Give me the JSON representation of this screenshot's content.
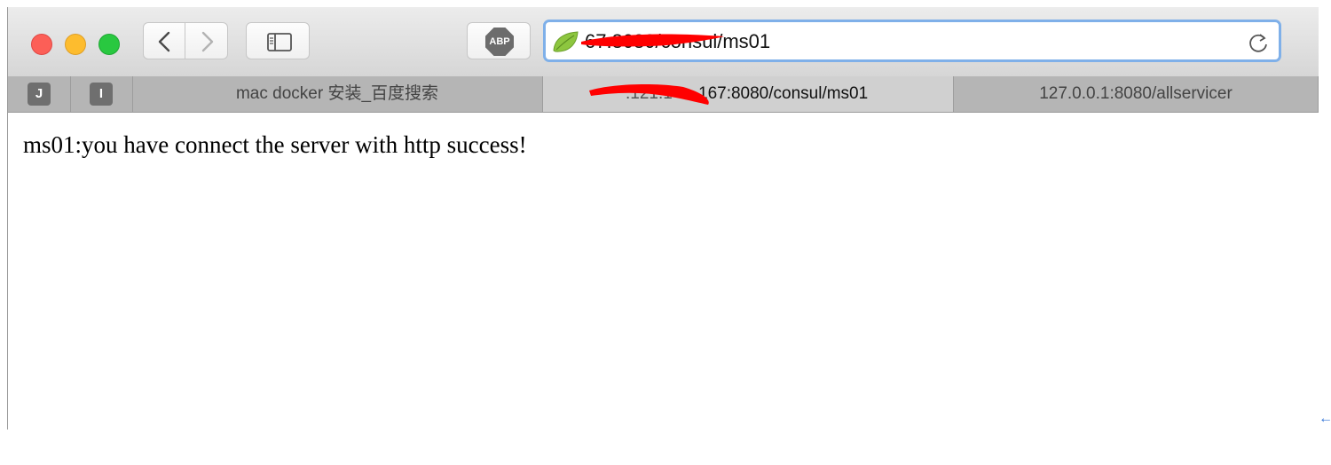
{
  "toolbar": {
    "abp_label": "ABP",
    "url": "67:8080/consul/ms01"
  },
  "pinned_tabs": [
    "J",
    "I"
  ],
  "tabs": [
    {
      "label": "mac docker 安装_百度搜索"
    },
    {
      "label": "167:8080/consul/ms01",
      "redacted_prefix": ".121.1"
    },
    {
      "label": "127.0.0.1:8080/allservicer"
    }
  ],
  "page": {
    "body_text": "ms01:you have connect the server with http success!"
  },
  "colors": {
    "close": "#fc5f57",
    "minimize": "#fdbc2e",
    "zoom": "#29c840",
    "address_focus": "#7fb0e9",
    "redaction": "#ff0000",
    "spring_leaf": "#8dc63f"
  },
  "icons": {
    "back": "chevron-left",
    "forward": "chevron-right",
    "sidebar": "sidebar-icon",
    "reload": "reload-icon",
    "site": "spring-leaf-icon"
  }
}
